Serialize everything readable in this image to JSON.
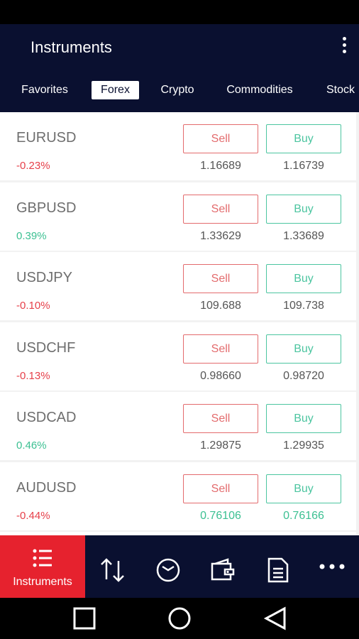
{
  "app": {
    "title": "Instruments"
  },
  "tabs": [
    {
      "label": "Favorites",
      "active": false
    },
    {
      "label": "Forex",
      "active": true
    },
    {
      "label": "Crypto",
      "active": false
    },
    {
      "label": "Commodities",
      "active": false
    },
    {
      "label": "Stock",
      "active": false
    }
  ],
  "instruments": [
    {
      "symbol": "EURUSD",
      "change": "-0.23%",
      "sell_label": "Sell",
      "buy_label": "Buy",
      "sell_price": "1.16689",
      "buy_price": "1.16739"
    },
    {
      "symbol": "GBPUSD",
      "change": "0.39%",
      "sell_label": "Sell",
      "buy_label": "Buy",
      "sell_price": "1.33629",
      "buy_price": "1.33689"
    },
    {
      "symbol": "USDJPY",
      "change": "-0.10%",
      "sell_label": "Sell",
      "buy_label": "Buy",
      "sell_price": "109.688",
      "buy_price": "109.738"
    },
    {
      "symbol": "USDCHF",
      "change": "-0.13%",
      "sell_label": "Sell",
      "buy_label": "Buy",
      "sell_price": "0.98660",
      "buy_price": "0.98720"
    },
    {
      "symbol": "USDCAD",
      "change": "0.46%",
      "sell_label": "Sell",
      "buy_label": "Buy",
      "sell_price": "1.29875",
      "buy_price": "1.29935"
    },
    {
      "symbol": "AUDUSD",
      "change": "-0.44%",
      "sell_label": "Sell",
      "buy_label": "Buy",
      "sell_price": "0.76106",
      "buy_price": "0.76166"
    }
  ],
  "bottom_nav": {
    "active_label": "Instruments",
    "items": [
      "list-icon",
      "arrows-updown-icon",
      "clock-icon",
      "wallet-icon",
      "document-icon",
      "more-dots-icon"
    ]
  },
  "colors": {
    "header_bg": "#0a1030",
    "negative": "#e6404a",
    "positive": "#3cc092",
    "sell": "#e36b6d",
    "buy": "#4cc5a0",
    "price_up": "#3cc092",
    "active_nav": "#e6222e"
  }
}
